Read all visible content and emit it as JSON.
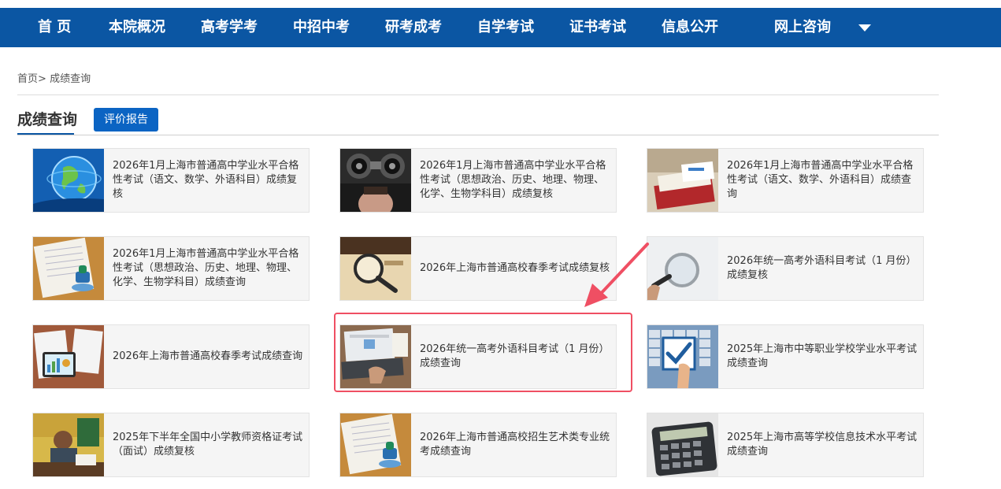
{
  "nav": {
    "items": [
      "首 页",
      "本院概况",
      "高考学考",
      "中招中考",
      "研考成考",
      "自学考试",
      "证书考试",
      "信息公开",
      "网上咨询"
    ]
  },
  "breadcrumb": {
    "home": "首页",
    "sep": ">",
    "current": "成绩查询"
  },
  "section": {
    "title": "成绩查询",
    "report_button": "评价报告"
  },
  "cards": [
    {
      "text": "2026年1月上海市普通高中学业水平合格性考试（语文、数学、外语科目）成绩复核",
      "icon": "globe-icon"
    },
    {
      "text": "2026年1月上海市普通高中学业水平合格性考试（思想政治、历史、地理、物理、化学、生物学科目）成绩复核",
      "icon": "eye-exam-icon"
    },
    {
      "text": "2026年1月上海市普通高中学业水平合格性考试（语文、数学、外语科目）成绩查询",
      "icon": "books-icon"
    },
    {
      "text": "2026年1月上海市普通高中学业水平合格性考试（思想政治、历史、地理、物理、化学、生物学科目）成绩查询",
      "icon": "stamp-document-icon"
    },
    {
      "text": "2026年上海市普通高校春季考试成绩复核",
      "icon": "magnifier-book-icon"
    },
    {
      "text": "2026年统一高考外语科目考试（1 月份）成绩复核",
      "icon": "magnifying-glass-icon"
    },
    {
      "text": "2026年上海市普通高校春季考试成绩查询",
      "icon": "tablet-charts-icon"
    },
    {
      "text": "2026年统一高考外语科目考试（1 月份）成绩查询",
      "icon": "laptop-icon"
    },
    {
      "text": "2025年上海市中等职业学校学业水平考试成绩查询",
      "icon": "keyboard-checkbox-icon"
    },
    {
      "text": "2025年下半年全国中小学教师资格证考试（面试）成绩复核",
      "icon": "student-desk-icon"
    },
    {
      "text": "2026年上海市普通高校招生艺术类专业统考成绩查询",
      "icon": "stamp-document-icon"
    },
    {
      "text": "2025年上海市高等学校信息技术水平考试成绩查询",
      "icon": "calculator-icon"
    }
  ],
  "colors": {
    "nav_bg": "#0b56a3",
    "button_bg": "#0b64c3",
    "highlight": "#ef4f63"
  }
}
